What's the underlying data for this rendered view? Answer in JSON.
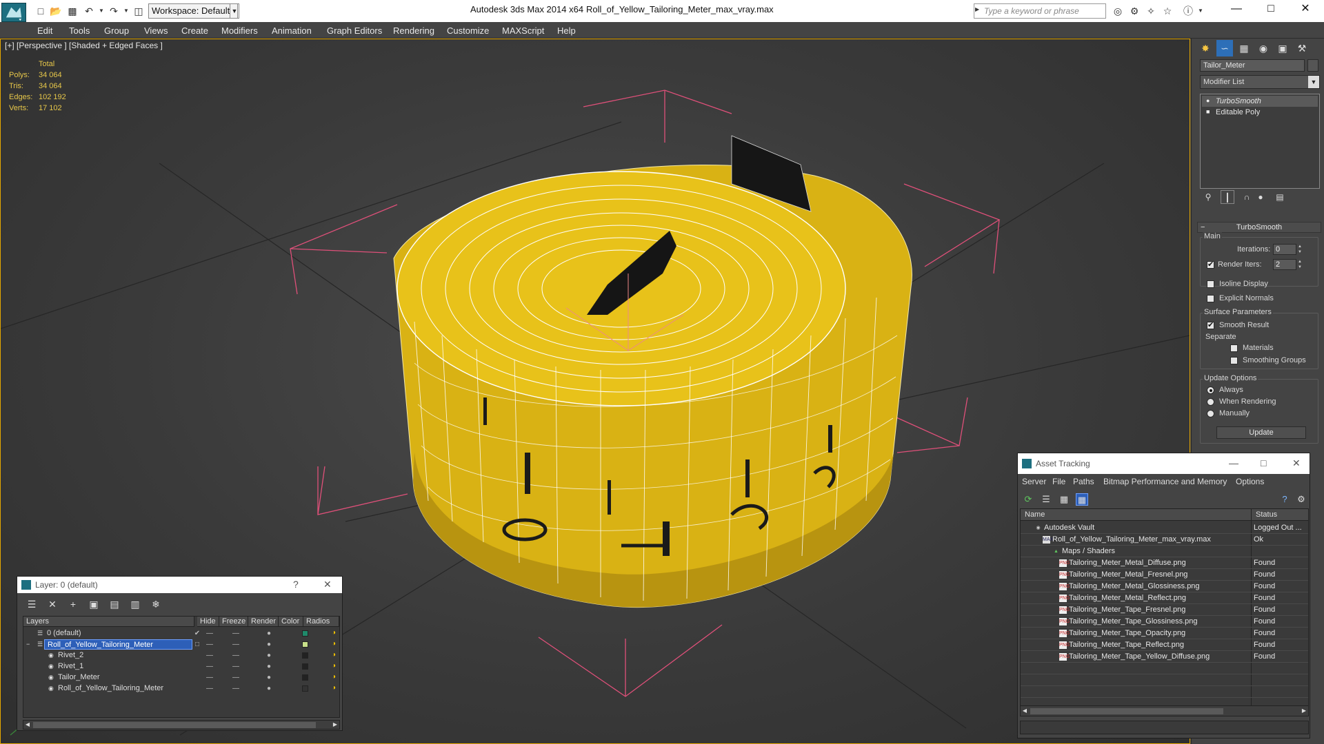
{
  "titlebar": {
    "workspace": "Workspace: Default",
    "app_title": "Autodesk 3ds Max  2014 x64",
    "file_title": "Roll_of_Yellow_Tailoring_Meter_max_vray.max",
    "search_placeholder": "Type a keyword or phrase"
  },
  "menu": [
    "Edit",
    "Tools",
    "Group",
    "Views",
    "Create",
    "Modifiers",
    "Animation",
    "Graph Editors",
    "Rendering",
    "Customize",
    "MAXScript",
    "Help"
  ],
  "viewport": {
    "label": "[+] [Perspective ] [Shaded + Edged Faces ]",
    "stats": {
      "header": "Total",
      "rows": [
        {
          "k": "Polys:",
          "v": "34 064"
        },
        {
          "k": "Tris:",
          "v": "34 064"
        },
        {
          "k": "Edges:",
          "v": "102 192"
        },
        {
          "k": "Verts:",
          "v": "17 102"
        }
      ]
    },
    "colors": {
      "tape": "#e8c21a",
      "tape_dark": "#b89410",
      "wire": "#ffffff",
      "grid": "#2a2a2a",
      "bracket": "#e0507a"
    }
  },
  "command_panel": {
    "object_name": "Tailor_Meter",
    "modifier_list": "Modifier List",
    "stack": [
      "TurboSmooth",
      "Editable Poly"
    ],
    "rollout": "TurboSmooth",
    "main_group": "Main",
    "iterations_label": "Iterations:",
    "iterations_value": "0",
    "render_iters_label": "Render Iters:",
    "render_iters_value": "2",
    "isoline": "Isoline Display",
    "explicit": "Explicit Normals",
    "surface_group": "Surface Parameters",
    "smooth_result": "Smooth Result",
    "separate": "Separate",
    "materials": "Materials",
    "smoothing_groups": "Smoothing Groups",
    "update_group": "Update Options",
    "always": "Always",
    "when_rendering": "When Rendering",
    "manually": "Manually",
    "update_btn": "Update"
  },
  "layer_dialog": {
    "title": "Layer: 0 (default)",
    "headers": [
      "Layers",
      "Hide",
      "Freeze",
      "Render",
      "Color",
      "Radios"
    ],
    "rows": [
      {
        "name": "0 (default)",
        "swatch": "#1f8a6a"
      },
      {
        "name": "Roll_of_Yellow_Tailoring_Meter",
        "swatch": "#c8e08a"
      },
      {
        "name": "Rivet_2",
        "swatch": "#222222"
      },
      {
        "name": "Rivet_1",
        "swatch": "#222222"
      },
      {
        "name": "Tailor_Meter",
        "swatch": "#222222"
      },
      {
        "name": "Roll_of_Yellow_Tailoring_Meter",
        "swatch": "#333333"
      }
    ]
  },
  "asset_dialog": {
    "title": "Asset Tracking",
    "menu": [
      "Server",
      "File",
      "Paths",
      "Bitmap Performance and Memory",
      "Options"
    ],
    "headers": [
      "Name",
      "Status"
    ],
    "rows": [
      {
        "name": "Autodesk Vault",
        "status": "Logged Out ..."
      },
      {
        "name": "Roll_of_Yellow_Tailoring_Meter_max_vray.max",
        "status": "Ok"
      },
      {
        "name": "Maps / Shaders",
        "status": ""
      },
      {
        "name": "Tailoring_Meter_Metal_Diffuse.png",
        "status": "Found"
      },
      {
        "name": "Tailoring_Meter_Metal_Fresnel.png",
        "status": "Found"
      },
      {
        "name": "Tailoring_Meter_Metal_Glossiness.png",
        "status": "Found"
      },
      {
        "name": "Tailoring_Meter_Metal_Reflect.png",
        "status": "Found"
      },
      {
        "name": "Tailoring_Meter_Tape_Fresnel.png",
        "status": "Found"
      },
      {
        "name": "Tailoring_Meter_Tape_Glossiness.png",
        "status": "Found"
      },
      {
        "name": "Tailoring_Meter_Tape_Opacity.png",
        "status": "Found"
      },
      {
        "name": "Tailoring_Meter_Tape_Reflect.png",
        "status": "Found"
      },
      {
        "name": "Tailoring_Meter_Tape_Yellow_Diffuse.png",
        "status": "Found"
      }
    ]
  }
}
